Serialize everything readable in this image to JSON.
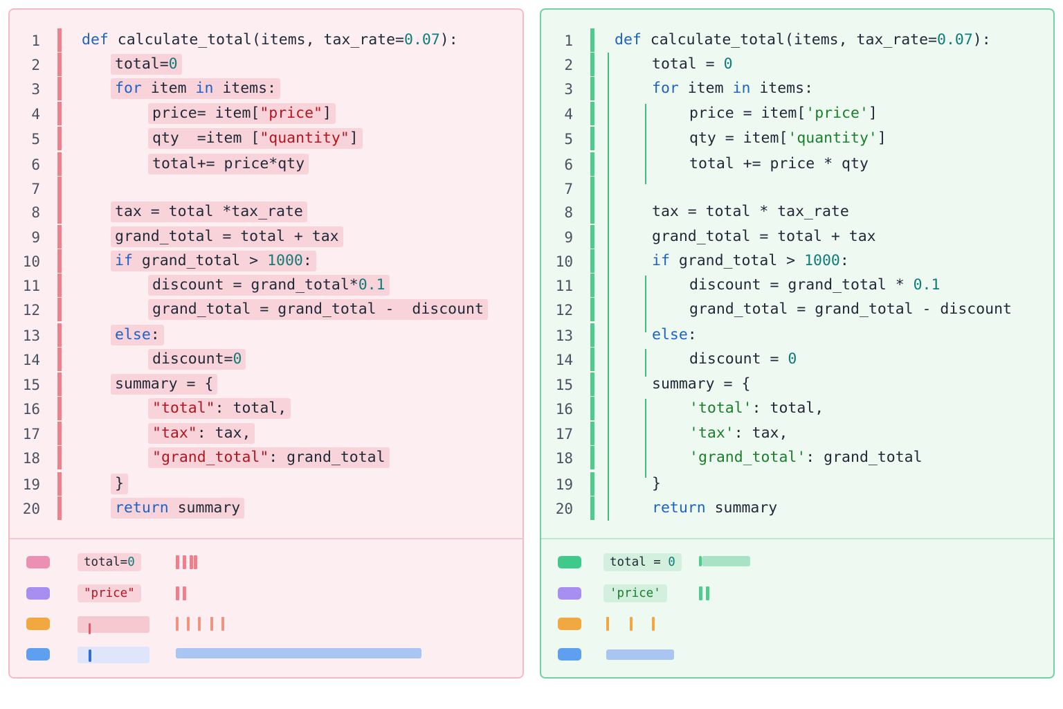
{
  "left": {
    "lines": [
      {
        "n": "1",
        "indent": 0,
        "tokens": [
          [
            "kw",
            "def"
          ],
          [
            "t",
            " calculate_total(items, tax_rate="
          ],
          [
            "num",
            "0.07"
          ],
          [
            "t",
            "):"
          ]
        ]
      },
      {
        "n": "2",
        "indent": 1,
        "tokens": [
          [
            "t",
            "total="
          ],
          [
            "num",
            "0"
          ]
        ]
      },
      {
        "n": "3",
        "indent": 1,
        "tokens": [
          [
            "kw",
            "for"
          ],
          [
            "t",
            " item "
          ],
          [
            "kw",
            "in"
          ],
          [
            "t",
            " items:"
          ]
        ]
      },
      {
        "n": "4",
        "indent": 2,
        "tokens": [
          [
            "t",
            "price= item["
          ],
          [
            "lstr",
            "\"price\""
          ],
          [
            "t",
            "]"
          ]
        ]
      },
      {
        "n": "5",
        "indent": 2,
        "tokens": [
          [
            "t",
            "qty  =item ["
          ],
          [
            "lstr",
            "\"quantity\""
          ],
          [
            "t",
            "]"
          ]
        ]
      },
      {
        "n": "6",
        "indent": 2,
        "tokens": [
          [
            "t",
            "total+= price*qty"
          ]
        ]
      },
      {
        "n": "7",
        "indent": 0,
        "tokens": []
      },
      {
        "n": "8",
        "indent": 1,
        "tokens": [
          [
            "t",
            "tax = total *tax_rate"
          ]
        ]
      },
      {
        "n": "9",
        "indent": 1,
        "tokens": [
          [
            "t",
            "grand_total = total + tax"
          ]
        ]
      },
      {
        "n": "10",
        "indent": 1,
        "tokens": [
          [
            "kw",
            "if"
          ],
          [
            "t",
            " grand_total > "
          ],
          [
            "num",
            "1000"
          ],
          [
            "t",
            ":"
          ]
        ]
      },
      {
        "n": "11",
        "indent": 2,
        "tokens": [
          [
            "t",
            "discount = grand_total*"
          ],
          [
            "num",
            "0.1"
          ]
        ]
      },
      {
        "n": "12",
        "indent": 2,
        "tokens": [
          [
            "t",
            "grand_total = grand_total -  discount"
          ]
        ]
      },
      {
        "n": "13",
        "indent": 1,
        "tokens": [
          [
            "kw",
            "else"
          ],
          [
            "t",
            ":"
          ]
        ]
      },
      {
        "n": "14",
        "indent": 2,
        "tokens": [
          [
            "t",
            "discount="
          ],
          [
            "num",
            "0"
          ]
        ]
      },
      {
        "n": "15",
        "indent": 1,
        "tokens": [
          [
            "t",
            "summary = {"
          ]
        ]
      },
      {
        "n": "16",
        "indent": 2,
        "tokens": [
          [
            "lstr",
            "\"total\""
          ],
          [
            "t",
            ": total,"
          ]
        ]
      },
      {
        "n": "17",
        "indent": 2,
        "tokens": [
          [
            "lstr",
            "\"tax\""
          ],
          [
            "t",
            ": tax,"
          ]
        ]
      },
      {
        "n": "18",
        "indent": 2,
        "tokens": [
          [
            "lstr",
            "\"grand_total\""
          ],
          [
            "t",
            ": grand_total"
          ]
        ]
      },
      {
        "n": "19",
        "indent": 1,
        "tokens": [
          [
            "t",
            "}"
          ]
        ]
      },
      {
        "n": "20",
        "indent": 1,
        "tokens": [
          [
            "kw",
            "return"
          ],
          [
            "t",
            " summary"
          ]
        ]
      }
    ],
    "legend": [
      {
        "swatch": "#ec8fb2",
        "label": [
          [
            "t",
            "total="
          ],
          [
            "num",
            "0"
          ]
        ]
      },
      {
        "swatch": "#a68ff0",
        "label": [
          [
            "lstr",
            "\"price\""
          ]
        ]
      },
      {
        "swatch": "#f2a840",
        "label": []
      },
      {
        "swatch": "#5e9ff0",
        "label": []
      }
    ]
  },
  "right": {
    "lines": [
      {
        "n": "1",
        "indent": 0,
        "tokens": [
          [
            "kw",
            "def"
          ],
          [
            "t",
            " calculate_total(items, tax_rate="
          ],
          [
            "num",
            "0.07"
          ],
          [
            "t",
            "):"
          ]
        ]
      },
      {
        "n": "2",
        "indent": 1,
        "tokens": [
          [
            "t",
            "total = "
          ],
          [
            "num",
            "0"
          ]
        ]
      },
      {
        "n": "3",
        "indent": 1,
        "tokens": [
          [
            "kw",
            "for"
          ],
          [
            "t",
            " item "
          ],
          [
            "kw",
            "in"
          ],
          [
            "t",
            " items:"
          ]
        ]
      },
      {
        "n": "4",
        "indent": 2,
        "tokens": [
          [
            "t",
            "price = item["
          ],
          [
            "rstr",
            "'price'"
          ],
          [
            "t",
            "]"
          ]
        ]
      },
      {
        "n": "5",
        "indent": 2,
        "tokens": [
          [
            "t",
            "qty = item["
          ],
          [
            "rstr",
            "'quantity'"
          ],
          [
            "t",
            "]"
          ]
        ]
      },
      {
        "n": "6",
        "indent": 2,
        "tokens": [
          [
            "t",
            "total += price * qty"
          ]
        ]
      },
      {
        "n": "7",
        "indent": 0,
        "tokens": []
      },
      {
        "n": "8",
        "indent": 1,
        "tokens": [
          [
            "t",
            "tax = total * tax_rate"
          ]
        ]
      },
      {
        "n": "9",
        "indent": 1,
        "tokens": [
          [
            "t",
            "grand_total = total + tax"
          ]
        ]
      },
      {
        "n": "10",
        "indent": 1,
        "tokens": [
          [
            "kw",
            "if"
          ],
          [
            "t",
            " grand_total > "
          ],
          [
            "num",
            "1000"
          ],
          [
            "t",
            ":"
          ]
        ]
      },
      {
        "n": "11",
        "indent": 2,
        "tokens": [
          [
            "t",
            "discount = grand_total * "
          ],
          [
            "num",
            "0.1"
          ]
        ]
      },
      {
        "n": "12",
        "indent": 2,
        "tokens": [
          [
            "t",
            "grand_total = grand_total - discount"
          ]
        ]
      },
      {
        "n": "13",
        "indent": 1,
        "tokens": [
          [
            "kw",
            "else"
          ],
          [
            "t",
            ":"
          ]
        ]
      },
      {
        "n": "14",
        "indent": 2,
        "tokens": [
          [
            "t",
            "discount = "
          ],
          [
            "num",
            "0"
          ]
        ]
      },
      {
        "n": "15",
        "indent": 1,
        "tokens": [
          [
            "t",
            "summary = {"
          ]
        ]
      },
      {
        "n": "16",
        "indent": 2,
        "tokens": [
          [
            "rstr",
            "'total'"
          ],
          [
            "t",
            ": total,"
          ]
        ]
      },
      {
        "n": "17",
        "indent": 2,
        "tokens": [
          [
            "rstr",
            "'tax'"
          ],
          [
            "t",
            ": tax,"
          ]
        ]
      },
      {
        "n": "18",
        "indent": 2,
        "tokens": [
          [
            "rstr",
            "'grand_total'"
          ],
          [
            "t",
            ": grand_total"
          ]
        ]
      },
      {
        "n": "19",
        "indent": 1,
        "tokens": [
          [
            "t",
            "}"
          ]
        ]
      },
      {
        "n": "20",
        "indent": 1,
        "tokens": [
          [
            "kw",
            "return"
          ],
          [
            "t",
            " summary"
          ]
        ]
      }
    ],
    "legend": [
      {
        "swatch": "#3fc98a",
        "label": [
          [
            "t",
            "total = "
          ],
          [
            "num",
            "0"
          ]
        ]
      },
      {
        "swatch": "#a68ff0",
        "label": [
          [
            "rstr",
            "'price'"
          ]
        ]
      },
      {
        "swatch": "#f2a840",
        "label": []
      },
      {
        "swatch": "#5e9ff0",
        "label": []
      }
    ]
  }
}
